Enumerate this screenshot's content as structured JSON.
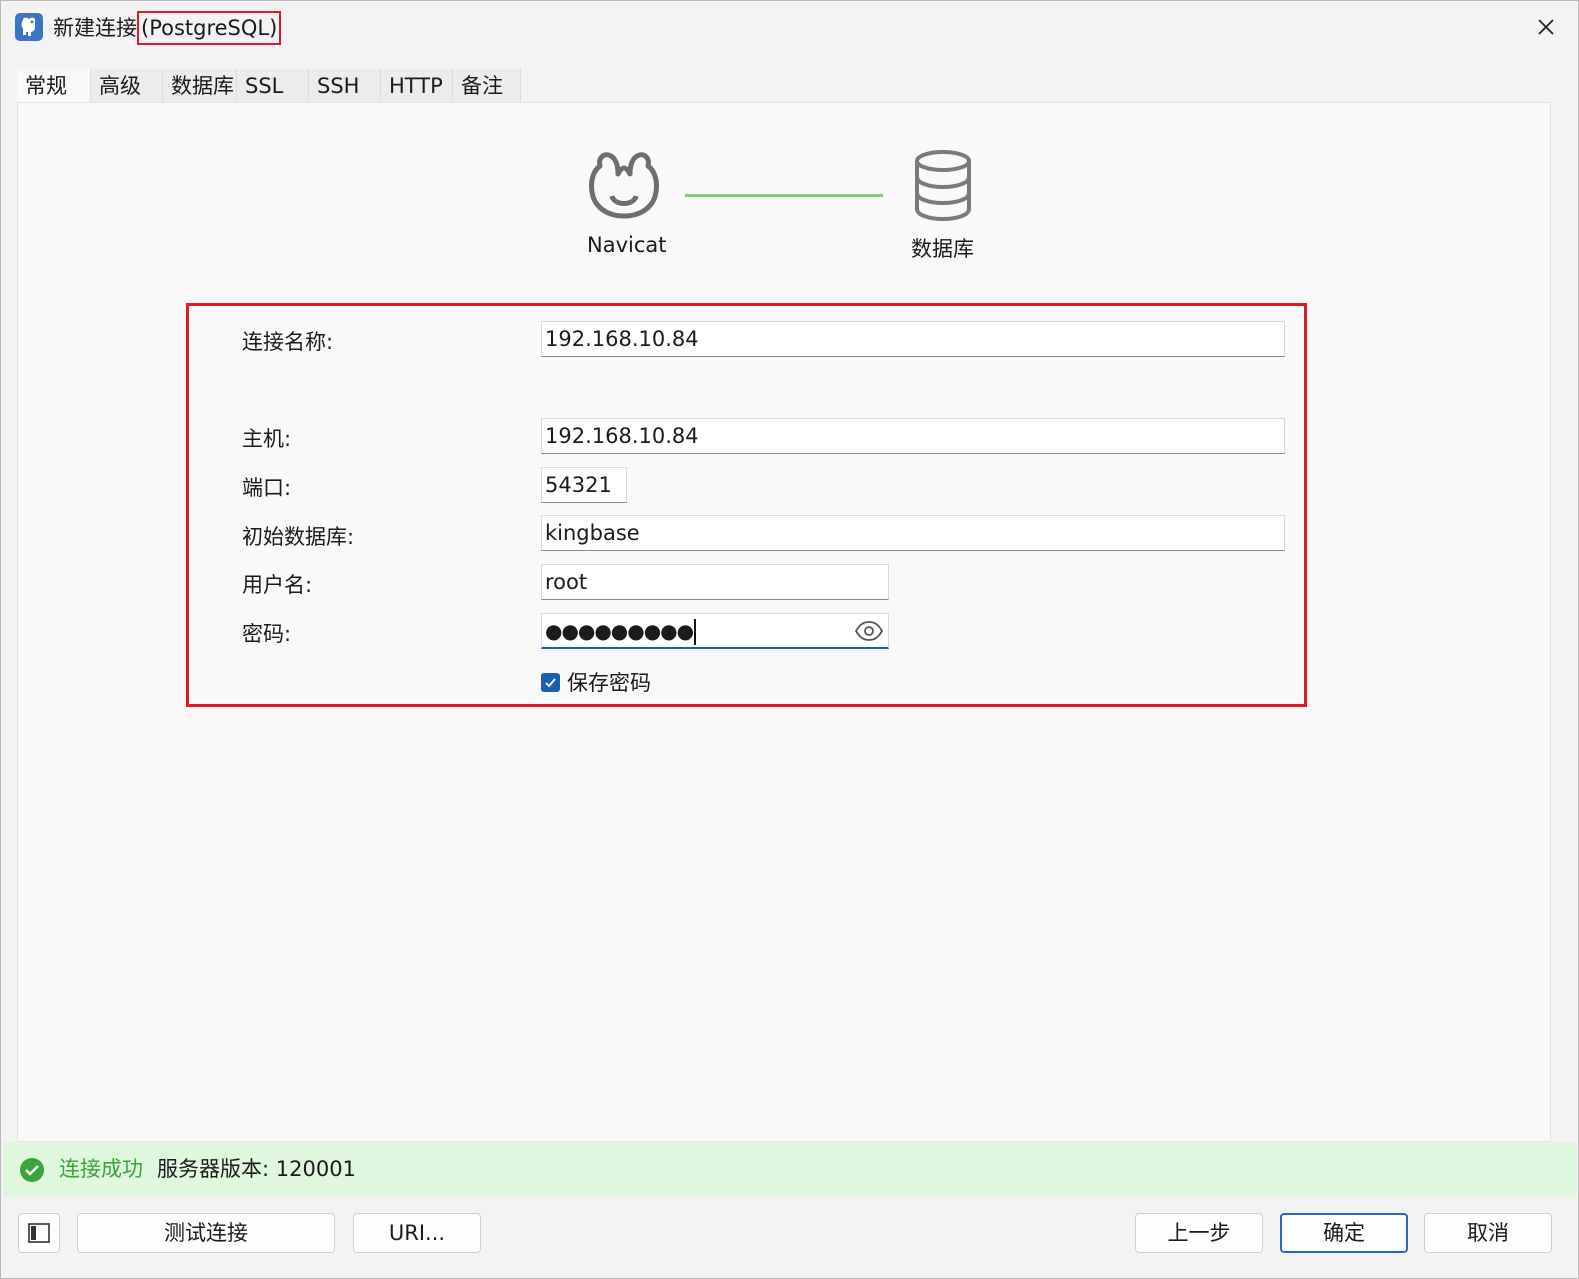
{
  "window": {
    "title_prefix": "新建连接",
    "title_highlight": "(PostgreSQL)"
  },
  "tabs": [
    {
      "label": "常规",
      "active": true
    },
    {
      "label": "高级"
    },
    {
      "label": "数据库"
    },
    {
      "label": "SSL"
    },
    {
      "label": "SSH"
    },
    {
      "label": "HTTP"
    },
    {
      "label": "备注"
    }
  ],
  "diagram": {
    "left_label": "Navicat",
    "right_label": "数据库",
    "line_color": "#7ccf6e"
  },
  "form": {
    "connection_name_label": "连接名称:",
    "connection_name_value": "192.168.10.84",
    "host_label": "主机:",
    "host_value": "192.168.10.84",
    "port_label": "端口:",
    "port_value": "54321",
    "initial_db_label": "初始数据库:",
    "initial_db_value": "kingbase",
    "username_label": "用户名:",
    "username_value": "root",
    "password_label": "密码:",
    "password_value": "●●●●●●●●●",
    "save_password_label": "保存密码",
    "save_password_checked": true
  },
  "status": {
    "success_text": "连接成功",
    "server_version": "服务器版本: 120001",
    "color": "#3ba53b"
  },
  "buttons": {
    "test_connection": "测试连接",
    "uri": "URI...",
    "previous": "上一步",
    "ok": "确定",
    "cancel": "取消"
  },
  "colors": {
    "highlight": "#e0192a",
    "accent": "#1c5db5",
    "status_bg": "#dff7dc"
  }
}
